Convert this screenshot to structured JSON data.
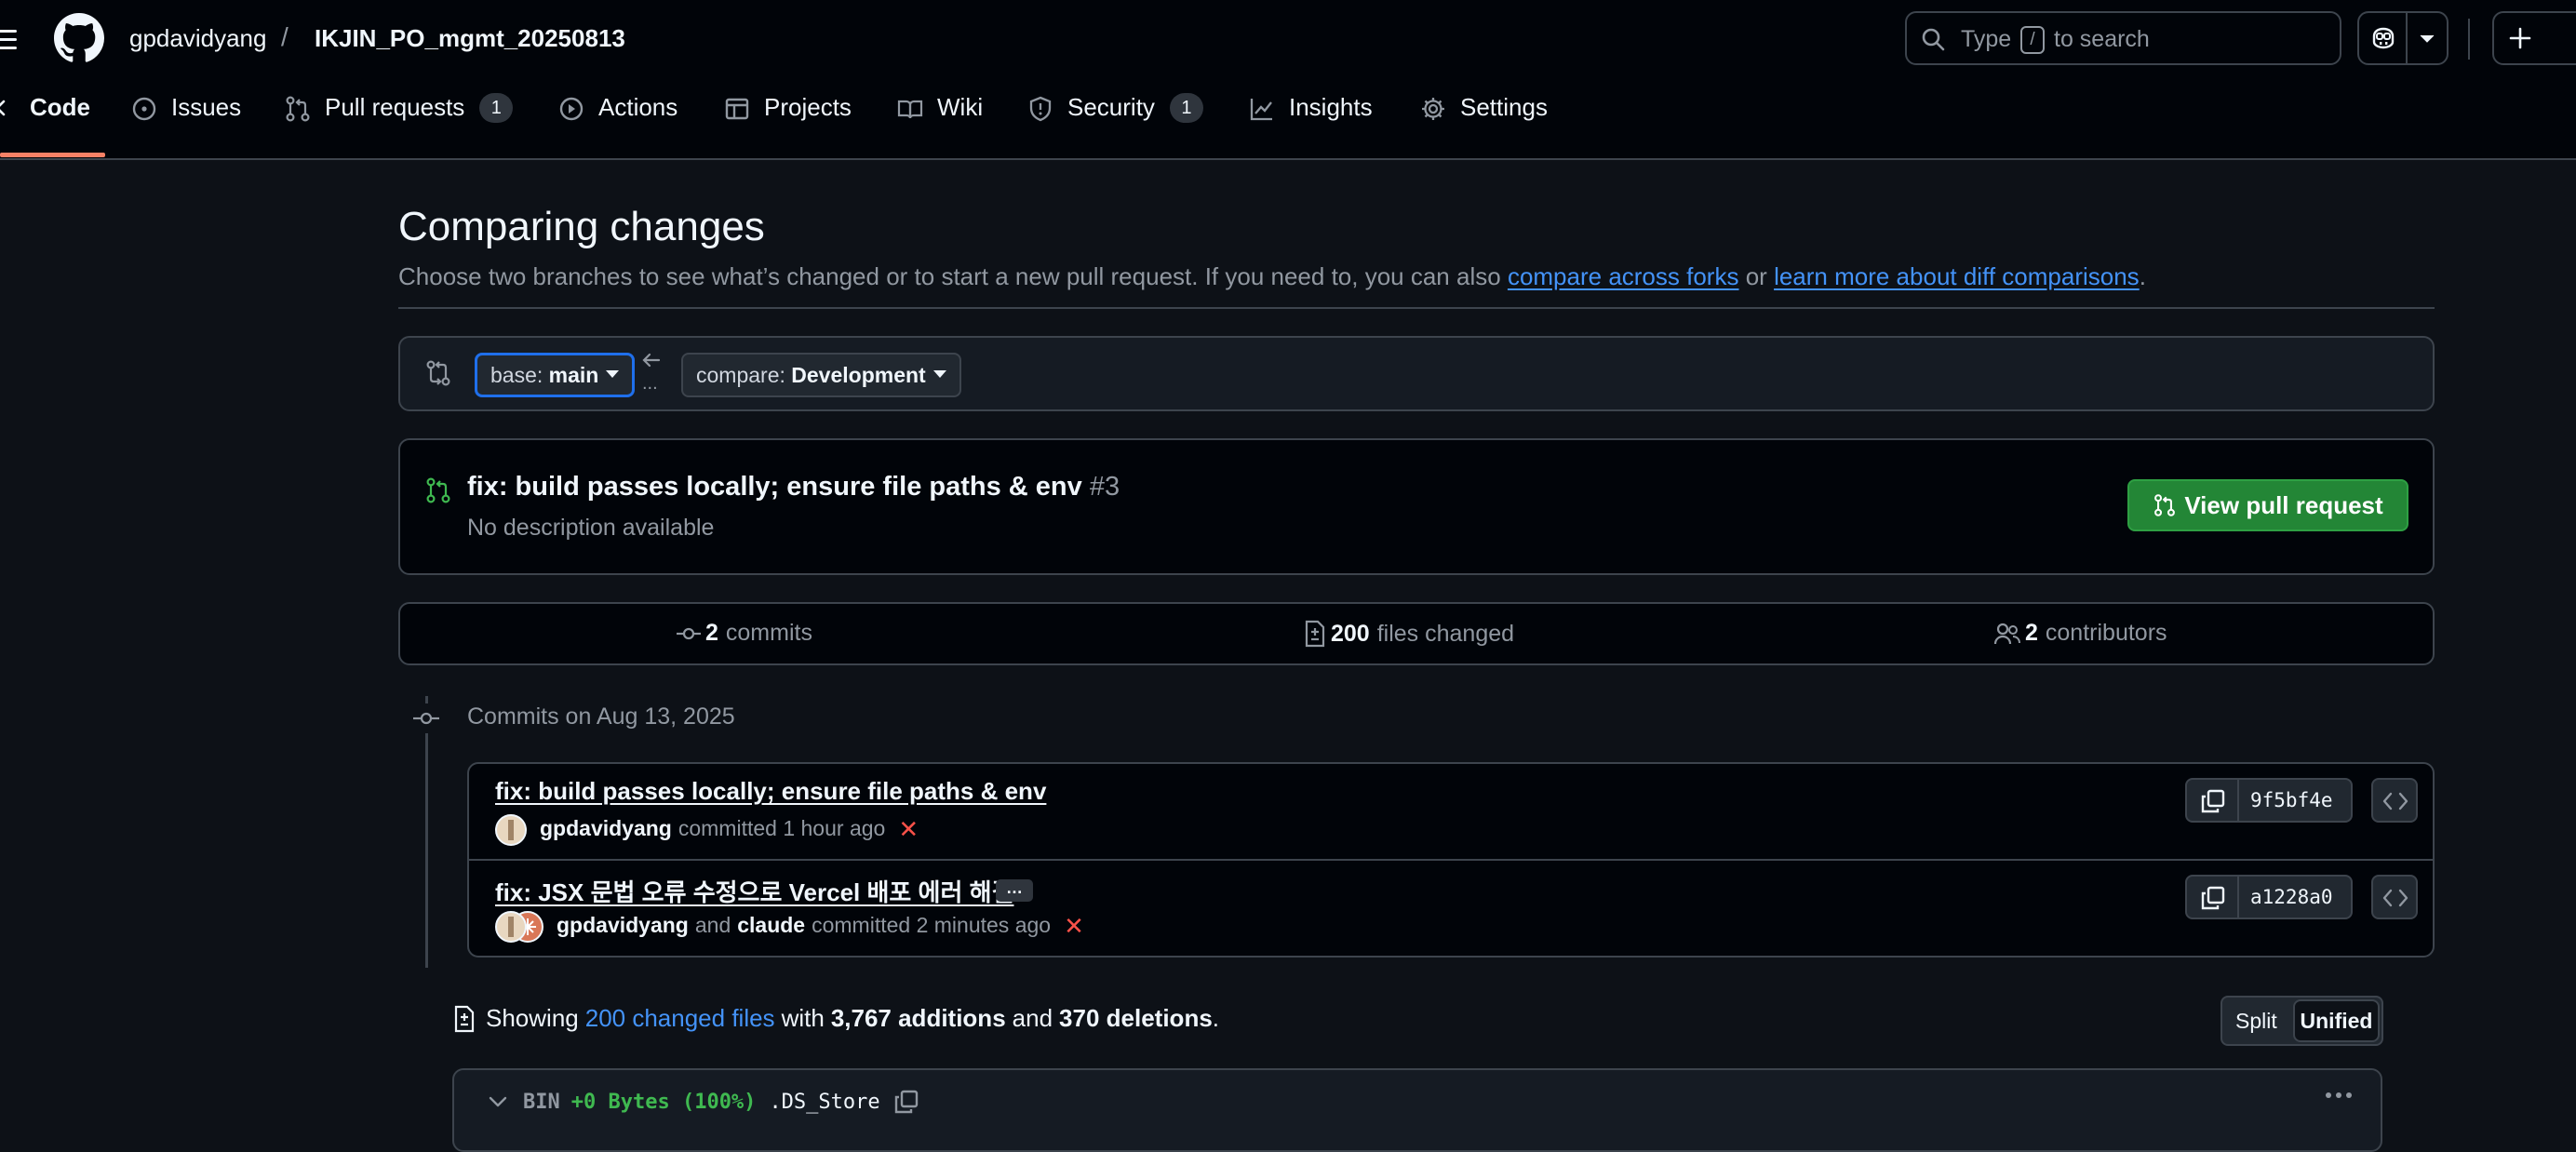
{
  "header": {
    "owner": "gpdavidyang",
    "slash": "/",
    "repo": "IKJIN_PO_mgmt_20250813",
    "search": {
      "before_key": "Type",
      "key": "/",
      "after_key": "to search"
    }
  },
  "nav": {
    "code": "Code",
    "issues": "Issues",
    "pull_requests": "Pull requests",
    "pull_requests_count": "1",
    "actions": "Actions",
    "projects": "Projects",
    "wiki": "Wiki",
    "security": "Security",
    "security_count": "1",
    "insights": "Insights",
    "settings": "Settings"
  },
  "compare": {
    "title": "Comparing changes",
    "subtitle_pre": "Choose two branches to see what’s changed or to start a new pull request. If you need to, you can also",
    "link_forks": "compare across forks",
    "or": "or",
    "link_learn": "learn more about diff comparisons",
    "period": ".",
    "base_prefix": "base:",
    "base_branch": "main",
    "compare_prefix": "compare:",
    "compare_branch": "Development",
    "dots": "..."
  },
  "pr": {
    "title": "fix: build passes locally; ensure file paths & env",
    "number": "#3",
    "description": "No description available",
    "button": "View pull request"
  },
  "stats": {
    "commits_count": "2",
    "commits_label": "commits",
    "files_count": "200",
    "files_label": "files changed",
    "contributors_count": "2",
    "contributors_label": "contributors"
  },
  "commits": {
    "date_header": "Commits on Aug 13, 2025",
    "items": [
      {
        "title": "fix: build passes locally; ensure file paths & env",
        "author": "gpdavidyang",
        "coauthor_joiner": "",
        "coauthor": "",
        "action": "committed 1 hour ago",
        "sha": "9f5bf4e"
      },
      {
        "title": "fix: JSX 문법 오류 수정으로 Vercel 배포 에러 해결",
        "ellipsis": "…",
        "author": "gpdavidyang",
        "coauthor_joiner": "and",
        "coauthor": "claude",
        "action": "committed 2 minutes ago",
        "sha": "a1228a0"
      }
    ]
  },
  "diff_summary": {
    "showing": "Showing",
    "changed_files": "200 changed files",
    "with": "with",
    "additions": "3,767 additions",
    "and": "and",
    "deletions": "370 deletions",
    "period": ".",
    "split": "Split",
    "unified": "Unified"
  },
  "file": {
    "type": "BIN",
    "change": "+0 Bytes (100%)",
    "name": ".DS_Store"
  },
  "colors": {
    "bg": "#0d1117",
    "header_bg": "#010409",
    "border": "#3d444d",
    "link": "#4493f8",
    "success": "#238636",
    "danger": "#f85149",
    "active_tab": "#f78166"
  }
}
